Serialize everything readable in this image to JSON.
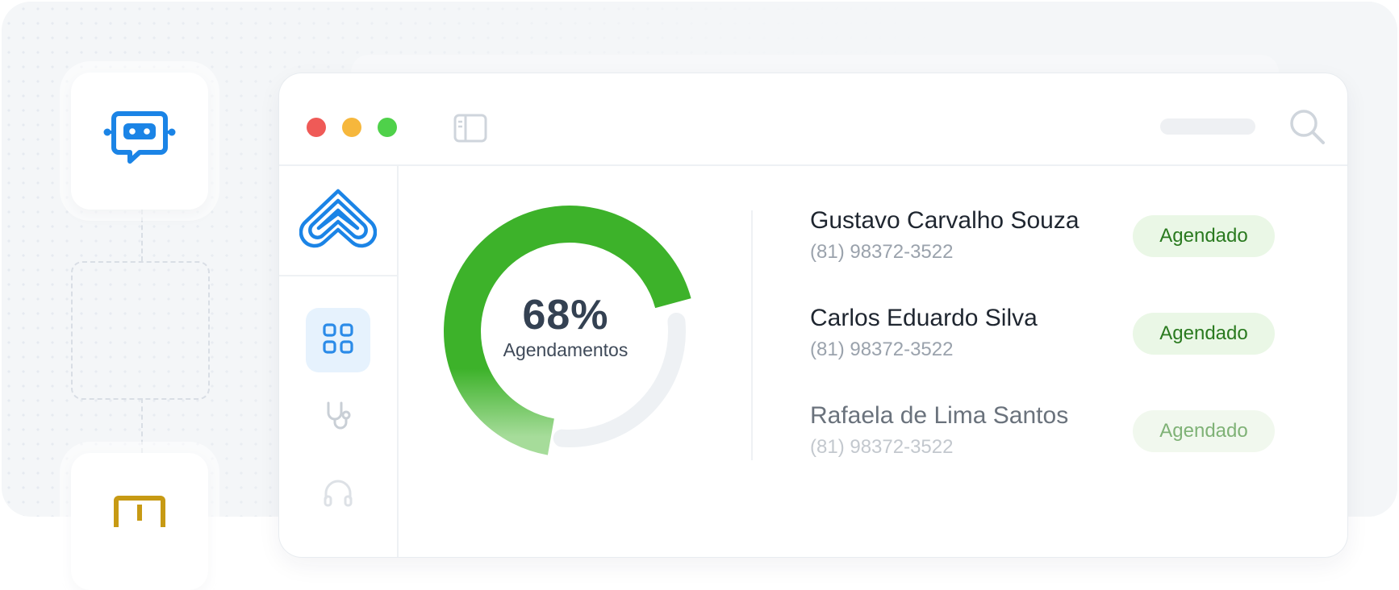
{
  "chart_data": {
    "type": "donut",
    "values": [
      68
    ],
    "value_unit": "%",
    "center_text": "68%",
    "center_label": "Agendamentos"
  },
  "patients": [
    {
      "name": "Gustavo Carvalho Souza",
      "phone": "(81) 98372-3522",
      "status": "Agendado"
    },
    {
      "name": "Carlos Eduardo Silva",
      "phone": "(81) 98372-3522",
      "status": "Agendado"
    },
    {
      "name": "Rafaela de Lima Santos",
      "phone": "(81) 98372-3522",
      "status": "Agendado"
    }
  ],
  "icons": {
    "workflow_top": "chat-bot-icon",
    "workflow_bottom": "alert-box-icon",
    "sidebar_toggle": "sidebar-toggle-icon",
    "search": "search-icon",
    "logo": "brand-logo-icon",
    "nav": [
      "dashboard-grid-icon",
      "stethoscope-icon",
      "headset-icon"
    ]
  },
  "colors": {
    "accent_blue": "#1b84e6",
    "donut_green": "#3db22a",
    "status_green": "#2a7a1f",
    "status_bg": "#eaf7e6",
    "traffic_red": "#ef5a57",
    "traffic_yellow": "#f6b73c",
    "traffic_green": "#4fd14a"
  }
}
